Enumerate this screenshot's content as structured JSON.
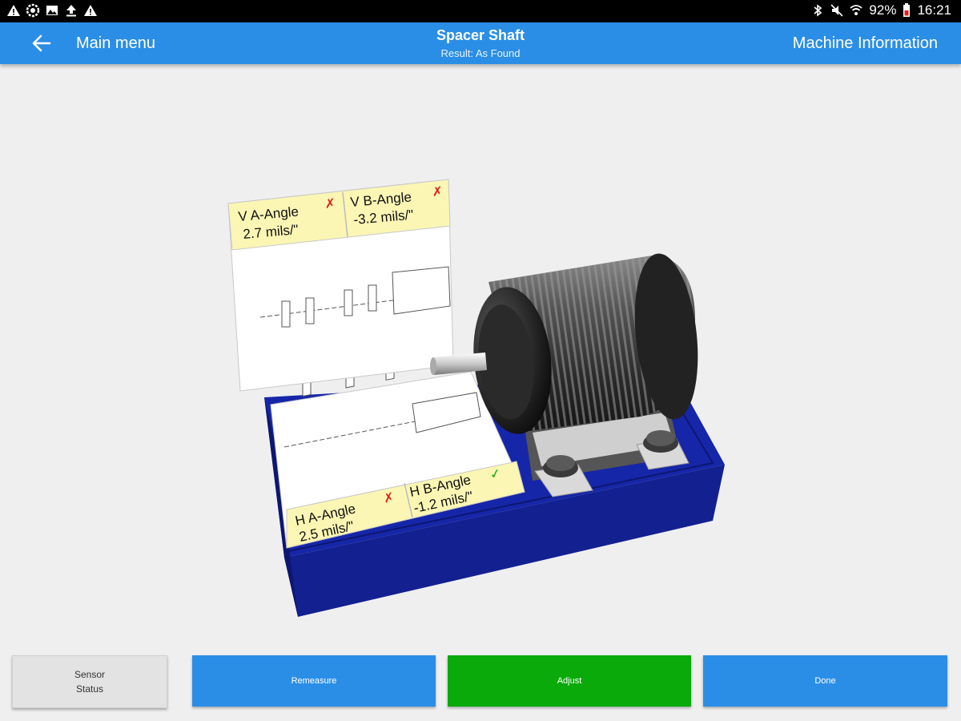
{
  "statusbar": {
    "battery": "92%",
    "time": "16:21"
  },
  "appbar": {
    "back_label": "Main menu",
    "title": "Spacer Shaft",
    "subtitle": "Result: As Found",
    "right_action": "Machine Information"
  },
  "cards": {
    "v_a_label": "V A-Angle",
    "v_a_value": "2.7 mils/\"",
    "v_b_label": "V B-Angle",
    "v_b_value": "-3.2 mils/\"",
    "h_a_label": "H A-Angle",
    "h_a_value": "2.5 mils/\"",
    "h_b_label": "H B-Angle",
    "h_b_value": "-1.2 mils/\""
  },
  "colors": {
    "accent": "#2b8ee6",
    "ok": "#0aaa0a",
    "fail": "#e02020",
    "card_bg": "#fbf6b4",
    "base_blue": "#1626a8"
  },
  "buttons": {
    "sensor_line1": "Sensor",
    "sensor_line2": "Status",
    "remeasure": "Remeasure",
    "adjust": "Adjust",
    "done": "Done"
  }
}
